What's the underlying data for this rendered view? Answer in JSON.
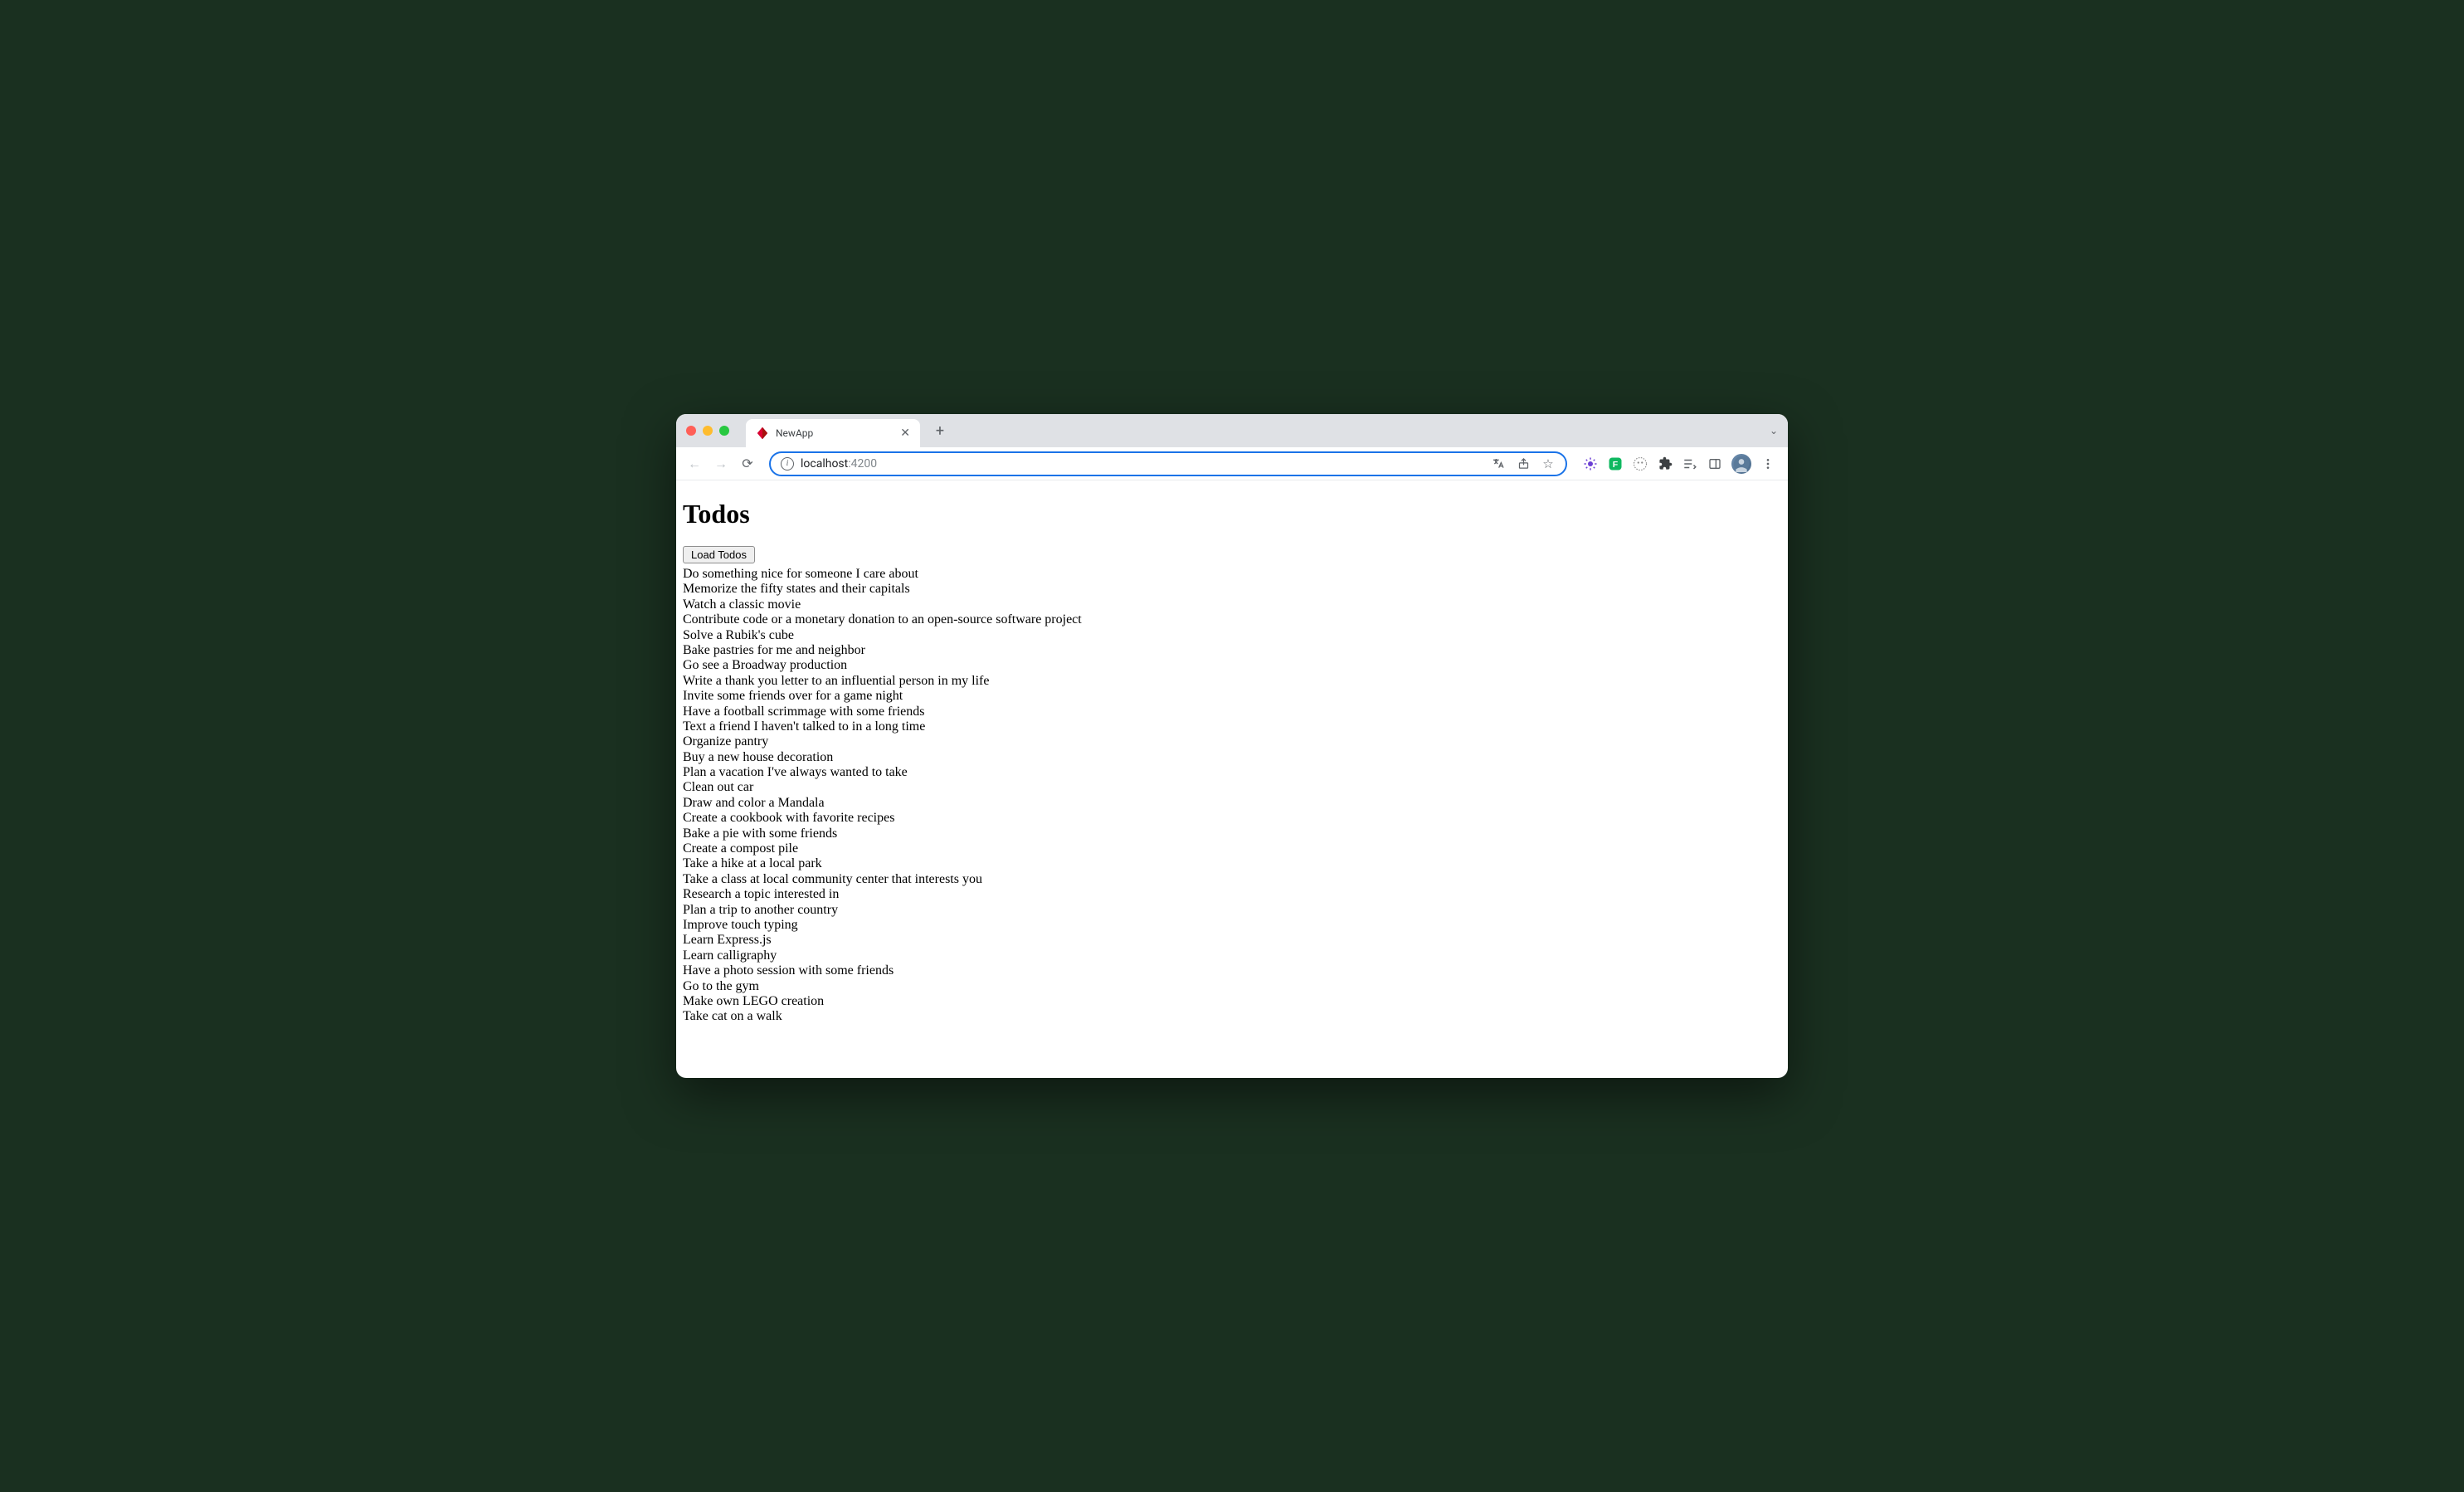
{
  "browser": {
    "tab": {
      "title": "NewApp"
    },
    "url": {
      "host": "localhost",
      "port": ":4200"
    }
  },
  "page": {
    "heading": "Todos",
    "load_button_label": "Load Todos",
    "todos": [
      "Do something nice for someone I care about",
      "Memorize the fifty states and their capitals",
      "Watch a classic movie",
      "Contribute code or a monetary donation to an open-source software project",
      "Solve a Rubik's cube",
      "Bake pastries for me and neighbor",
      "Go see a Broadway production",
      "Write a thank you letter to an influential person in my life",
      "Invite some friends over for a game night",
      "Have a football scrimmage with some friends",
      "Text a friend I haven't talked to in a long time",
      "Organize pantry",
      "Buy a new house decoration",
      "Plan a vacation I've always wanted to take",
      "Clean out car",
      "Draw and color a Mandala",
      "Create a cookbook with favorite recipes",
      "Bake a pie with some friends",
      "Create a compost pile",
      "Take a hike at a local park",
      "Take a class at local community center that interests you",
      "Research a topic interested in",
      "Plan a trip to another country",
      "Improve touch typing",
      "Learn Express.js",
      "Learn calligraphy",
      "Have a photo session with some friends",
      "Go to the gym",
      "Make own LEGO creation",
      "Take cat on a walk"
    ]
  }
}
